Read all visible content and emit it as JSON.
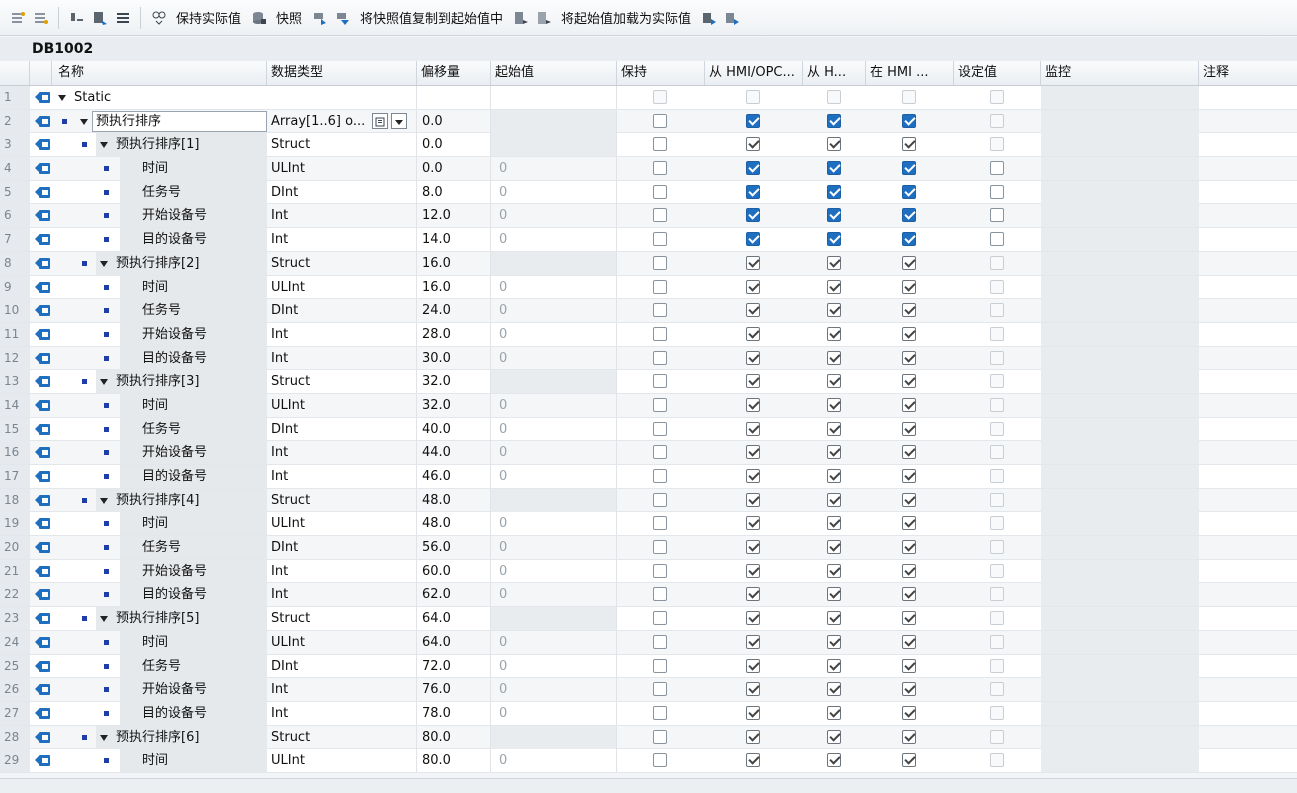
{
  "toolbar": {
    "keep_actual": "保持实际值",
    "snapshot": "快照",
    "copy_snapshot": "将快照值复制到起始值中",
    "load_start": "将起始值加载为实际值"
  },
  "db_title": "DB1002",
  "columns": {
    "name": "名称",
    "datatype": "数据类型",
    "offset": "偏移量",
    "start": "起始值",
    "retain": "保持",
    "hmi_opc": "从 HMI/OPC...",
    "from_h": "从 H...",
    "in_hmi": "在 HMI ...",
    "setpoint": "设定值",
    "monitor": "监控",
    "comment": "注释"
  },
  "rows": [
    {
      "n": "1",
      "name": "Static",
      "lvl": 0,
      "expand": true,
      "bullet": false,
      "type": "",
      "off": "",
      "start": "",
      "chk": "none"
    },
    {
      "n": "2",
      "name": "预执行排序",
      "lvl": 1,
      "expand": true,
      "bullet": true,
      "type": "Array[1..6] o...",
      "off": "0.0",
      "start": "",
      "chk": "array"
    },
    {
      "n": "3",
      "name": "预执行排序[1]",
      "lvl": 2,
      "expand": true,
      "bullet": true,
      "type": "Struct",
      "off": "0.0",
      "start": "",
      "chk": "greyset"
    },
    {
      "n": "4",
      "name": "时间",
      "lvl": 3,
      "expand": false,
      "bullet": true,
      "type": "ULInt",
      "off": "0.0",
      "start": "0",
      "chk": "blue"
    },
    {
      "n": "5",
      "name": "任务号",
      "lvl": 3,
      "expand": false,
      "bullet": true,
      "type": "DInt",
      "off": "8.0",
      "start": "0",
      "chk": "blue"
    },
    {
      "n": "6",
      "name": "开始设备号",
      "lvl": 3,
      "expand": false,
      "bullet": true,
      "type": "Int",
      "off": "12.0",
      "start": "0",
      "chk": "blue"
    },
    {
      "n": "7",
      "name": "目的设备号",
      "lvl": 3,
      "expand": false,
      "bullet": true,
      "type": "Int",
      "off": "14.0",
      "start": "0",
      "chk": "blue"
    },
    {
      "n": "8",
      "name": "预执行排序[2]",
      "lvl": 2,
      "expand": true,
      "bullet": true,
      "type": "Struct",
      "off": "16.0",
      "start": "",
      "chk": "greystruct"
    },
    {
      "n": "9",
      "name": "时间",
      "lvl": 3,
      "expand": false,
      "bullet": true,
      "type": "ULInt",
      "off": "16.0",
      "start": "0",
      "chk": "grey"
    },
    {
      "n": "10",
      "name": "任务号",
      "lvl": 3,
      "expand": false,
      "bullet": true,
      "type": "DInt",
      "off": "24.0",
      "start": "0",
      "chk": "grey"
    },
    {
      "n": "11",
      "name": "开始设备号",
      "lvl": 3,
      "expand": false,
      "bullet": true,
      "type": "Int",
      "off": "28.0",
      "start": "0",
      "chk": "grey"
    },
    {
      "n": "12",
      "name": "目的设备号",
      "lvl": 3,
      "expand": false,
      "bullet": true,
      "type": "Int",
      "off": "30.0",
      "start": "0",
      "chk": "grey"
    },
    {
      "n": "13",
      "name": "预执行排序[3]",
      "lvl": 2,
      "expand": true,
      "bullet": true,
      "type": "Struct",
      "off": "32.0",
      "start": "",
      "chk": "greystruct"
    },
    {
      "n": "14",
      "name": "时间",
      "lvl": 3,
      "expand": false,
      "bullet": true,
      "type": "ULInt",
      "off": "32.0",
      "start": "0",
      "chk": "grey"
    },
    {
      "n": "15",
      "name": "任务号",
      "lvl": 3,
      "expand": false,
      "bullet": true,
      "type": "DInt",
      "off": "40.0",
      "start": "0",
      "chk": "grey"
    },
    {
      "n": "16",
      "name": "开始设备号",
      "lvl": 3,
      "expand": false,
      "bullet": true,
      "type": "Int",
      "off": "44.0",
      "start": "0",
      "chk": "grey"
    },
    {
      "n": "17",
      "name": "目的设备号",
      "lvl": 3,
      "expand": false,
      "bullet": true,
      "type": "Int",
      "off": "46.0",
      "start": "0",
      "chk": "grey"
    },
    {
      "n": "18",
      "name": "预执行排序[4]",
      "lvl": 2,
      "expand": true,
      "bullet": true,
      "type": "Struct",
      "off": "48.0",
      "start": "",
      "chk": "greystruct"
    },
    {
      "n": "19",
      "name": "时间",
      "lvl": 3,
      "expand": false,
      "bullet": true,
      "type": "ULInt",
      "off": "48.0",
      "start": "0",
      "chk": "grey"
    },
    {
      "n": "20",
      "name": "任务号",
      "lvl": 3,
      "expand": false,
      "bullet": true,
      "type": "DInt",
      "off": "56.0",
      "start": "0",
      "chk": "grey"
    },
    {
      "n": "21",
      "name": "开始设备号",
      "lvl": 3,
      "expand": false,
      "bullet": true,
      "type": "Int",
      "off": "60.0",
      "start": "0",
      "chk": "grey"
    },
    {
      "n": "22",
      "name": "目的设备号",
      "lvl": 3,
      "expand": false,
      "bullet": true,
      "type": "Int",
      "off": "62.0",
      "start": "0",
      "chk": "grey"
    },
    {
      "n": "23",
      "name": "预执行排序[5]",
      "lvl": 2,
      "expand": true,
      "bullet": true,
      "type": "Struct",
      "off": "64.0",
      "start": "",
      "chk": "greystruct"
    },
    {
      "n": "24",
      "name": "时间",
      "lvl": 3,
      "expand": false,
      "bullet": true,
      "type": "ULInt",
      "off": "64.0",
      "start": "0",
      "chk": "grey"
    },
    {
      "n": "25",
      "name": "任务号",
      "lvl": 3,
      "expand": false,
      "bullet": true,
      "type": "DInt",
      "off": "72.0",
      "start": "0",
      "chk": "grey"
    },
    {
      "n": "26",
      "name": "开始设备号",
      "lvl": 3,
      "expand": false,
      "bullet": true,
      "type": "Int",
      "off": "76.0",
      "start": "0",
      "chk": "grey"
    },
    {
      "n": "27",
      "name": "目的设备号",
      "lvl": 3,
      "expand": false,
      "bullet": true,
      "type": "Int",
      "off": "78.0",
      "start": "0",
      "chk": "grey"
    },
    {
      "n": "28",
      "name": "预执行排序[6]",
      "lvl": 2,
      "expand": true,
      "bullet": true,
      "type": "Struct",
      "off": "80.0",
      "start": "",
      "chk": "greystruct"
    },
    {
      "n": "29",
      "name": "时间",
      "lvl": 3,
      "expand": false,
      "bullet": true,
      "type": "ULInt",
      "off": "80.0",
      "start": "0",
      "chk": "grey"
    }
  ],
  "colors": {
    "accent": "#1f6fc0",
    "header_bg": "#eaeef2",
    "bullet": "#1f3ea8"
  }
}
